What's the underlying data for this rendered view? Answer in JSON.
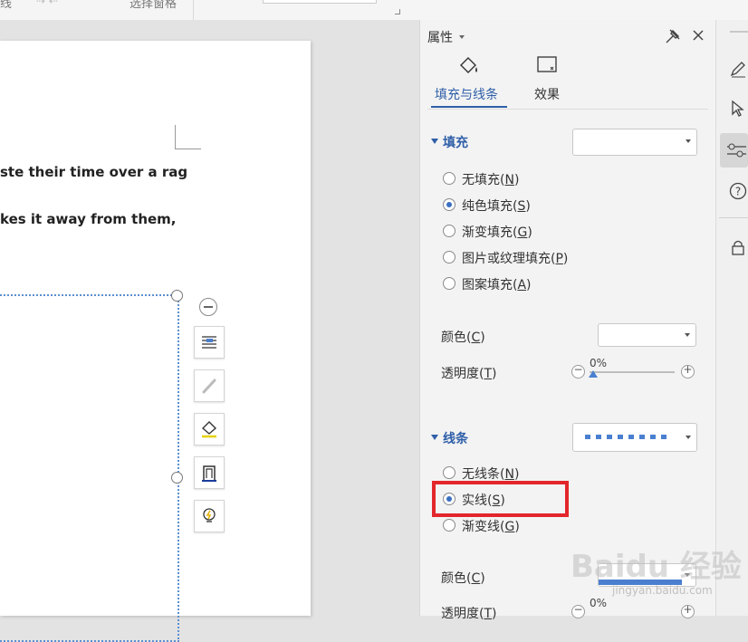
{
  "toolbar": {
    "partial_left": "线",
    "partial_mid": "选择窗格"
  },
  "document": {
    "line1": "ste their time over a rag",
    "line2": "kes it away from them,"
  },
  "panel": {
    "title": "属性",
    "tabs": [
      {
        "label": "填充与线条",
        "active": true
      },
      {
        "label": "效果",
        "active": false
      }
    ],
    "fill": {
      "heading": "填充",
      "options": [
        {
          "label": "无填充(N)",
          "text": "无填充(",
          "key": "N",
          "selected": false
        },
        {
          "label": "纯色填充(S)",
          "text": "纯色填充(",
          "key": "S",
          "selected": true
        },
        {
          "label": "渐变填充(G)",
          "text": "渐变填充(",
          "key": "G",
          "selected": false
        },
        {
          "label": "图片或纹理填充(P)",
          "text": "图片或纹理填充(",
          "key": "P",
          "selected": false
        },
        {
          "label": "图案填充(A)",
          "text": "图案填充(",
          "key": "A",
          "selected": false
        }
      ],
      "color_label": "颜色(",
      "color_key": "C",
      "transparency_label": "透明度(",
      "transparency_key": "T",
      "transparency_value": "0%",
      "transparency": 0
    },
    "line": {
      "heading": "线条",
      "options": [
        {
          "label": "无线条(N)",
          "text": "无线条(",
          "key": "N",
          "selected": false
        },
        {
          "label": "实线(S)",
          "text": "实线(",
          "key": "S",
          "selected": true
        },
        {
          "label": "渐变线(G)",
          "text": "渐变线(",
          "key": "G",
          "selected": false
        }
      ],
      "color_label": "颜色(",
      "color_key": "C",
      "transparency_label": "透明度(",
      "transparency_key": "T",
      "transparency_value": "0%",
      "transparency": 0
    }
  },
  "watermark": {
    "brand": "Baidu 经验",
    "url": "jingyan.baidu.com"
  },
  "colors": {
    "accent": "#2f5fa8",
    "highlight": "#e3262b",
    "selection_border": "#5b8fd0"
  }
}
